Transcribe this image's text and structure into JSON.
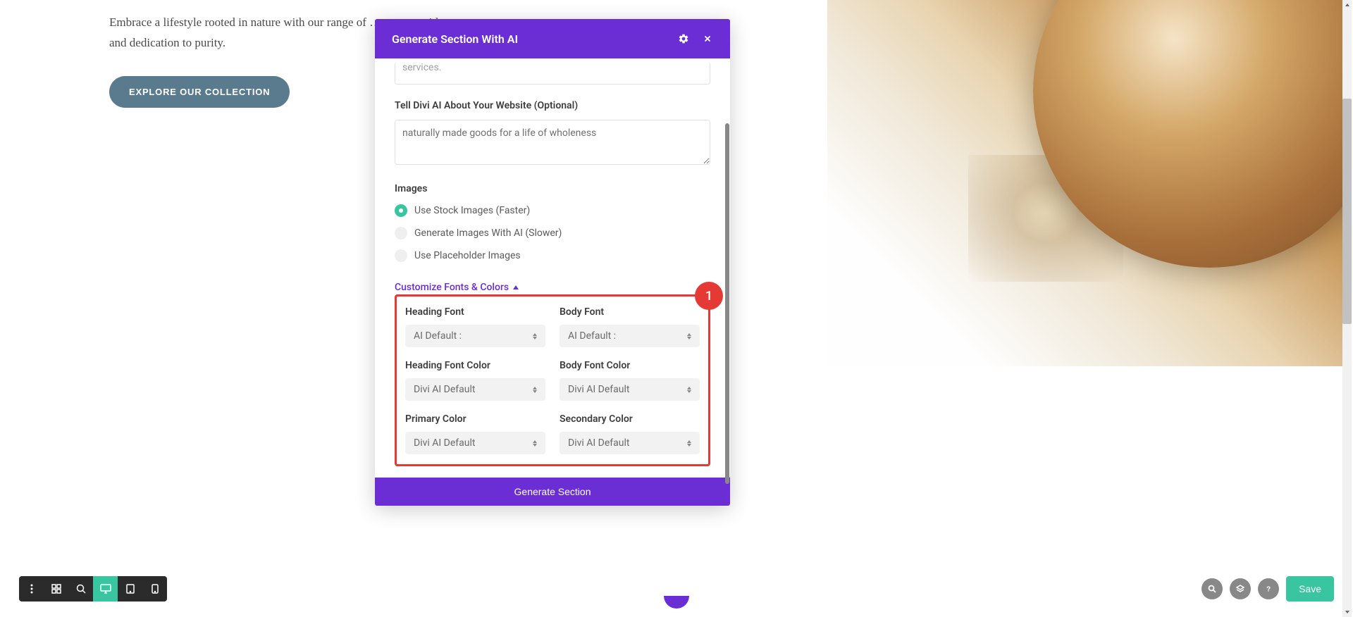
{
  "hero": {
    "text": "Embrace a lifestyle rooted in nature with our range of …, …, … with care and dedication to purity.",
    "cta": "EXPLORE OUR COLLECTION"
  },
  "modal": {
    "title": "Generate Section With AI",
    "topTextareaTail": "services.",
    "websiteLabel": "Tell Divi AI About Your Website (Optional)",
    "websiteValue": "naturally made goods for a life of wholeness",
    "imagesLabel": "Images",
    "imageOptions": {
      "stock": "Use Stock Images (Faster)",
      "ai": "Generate Images With AI (Slower)",
      "placeholder": "Use Placeholder Images"
    },
    "customizeLink": "Customize Fonts & Colors",
    "fields": {
      "headingFont": {
        "label": "Heading Font",
        "value": "AI Default :"
      },
      "bodyFont": {
        "label": "Body Font",
        "value": "AI Default :"
      },
      "headingFontColor": {
        "label": "Heading Font Color",
        "value": "Divi AI Default"
      },
      "bodyFontColor": {
        "label": "Body Font Color",
        "value": "Divi AI Default"
      },
      "primaryColor": {
        "label": "Primary Color",
        "value": "Divi AI Default"
      },
      "secondaryColor": {
        "label": "Secondary Color",
        "value": "Divi AI Default"
      }
    },
    "badge": "1",
    "generateBtn": "Generate Section"
  },
  "footer": {
    "save": "Save"
  }
}
